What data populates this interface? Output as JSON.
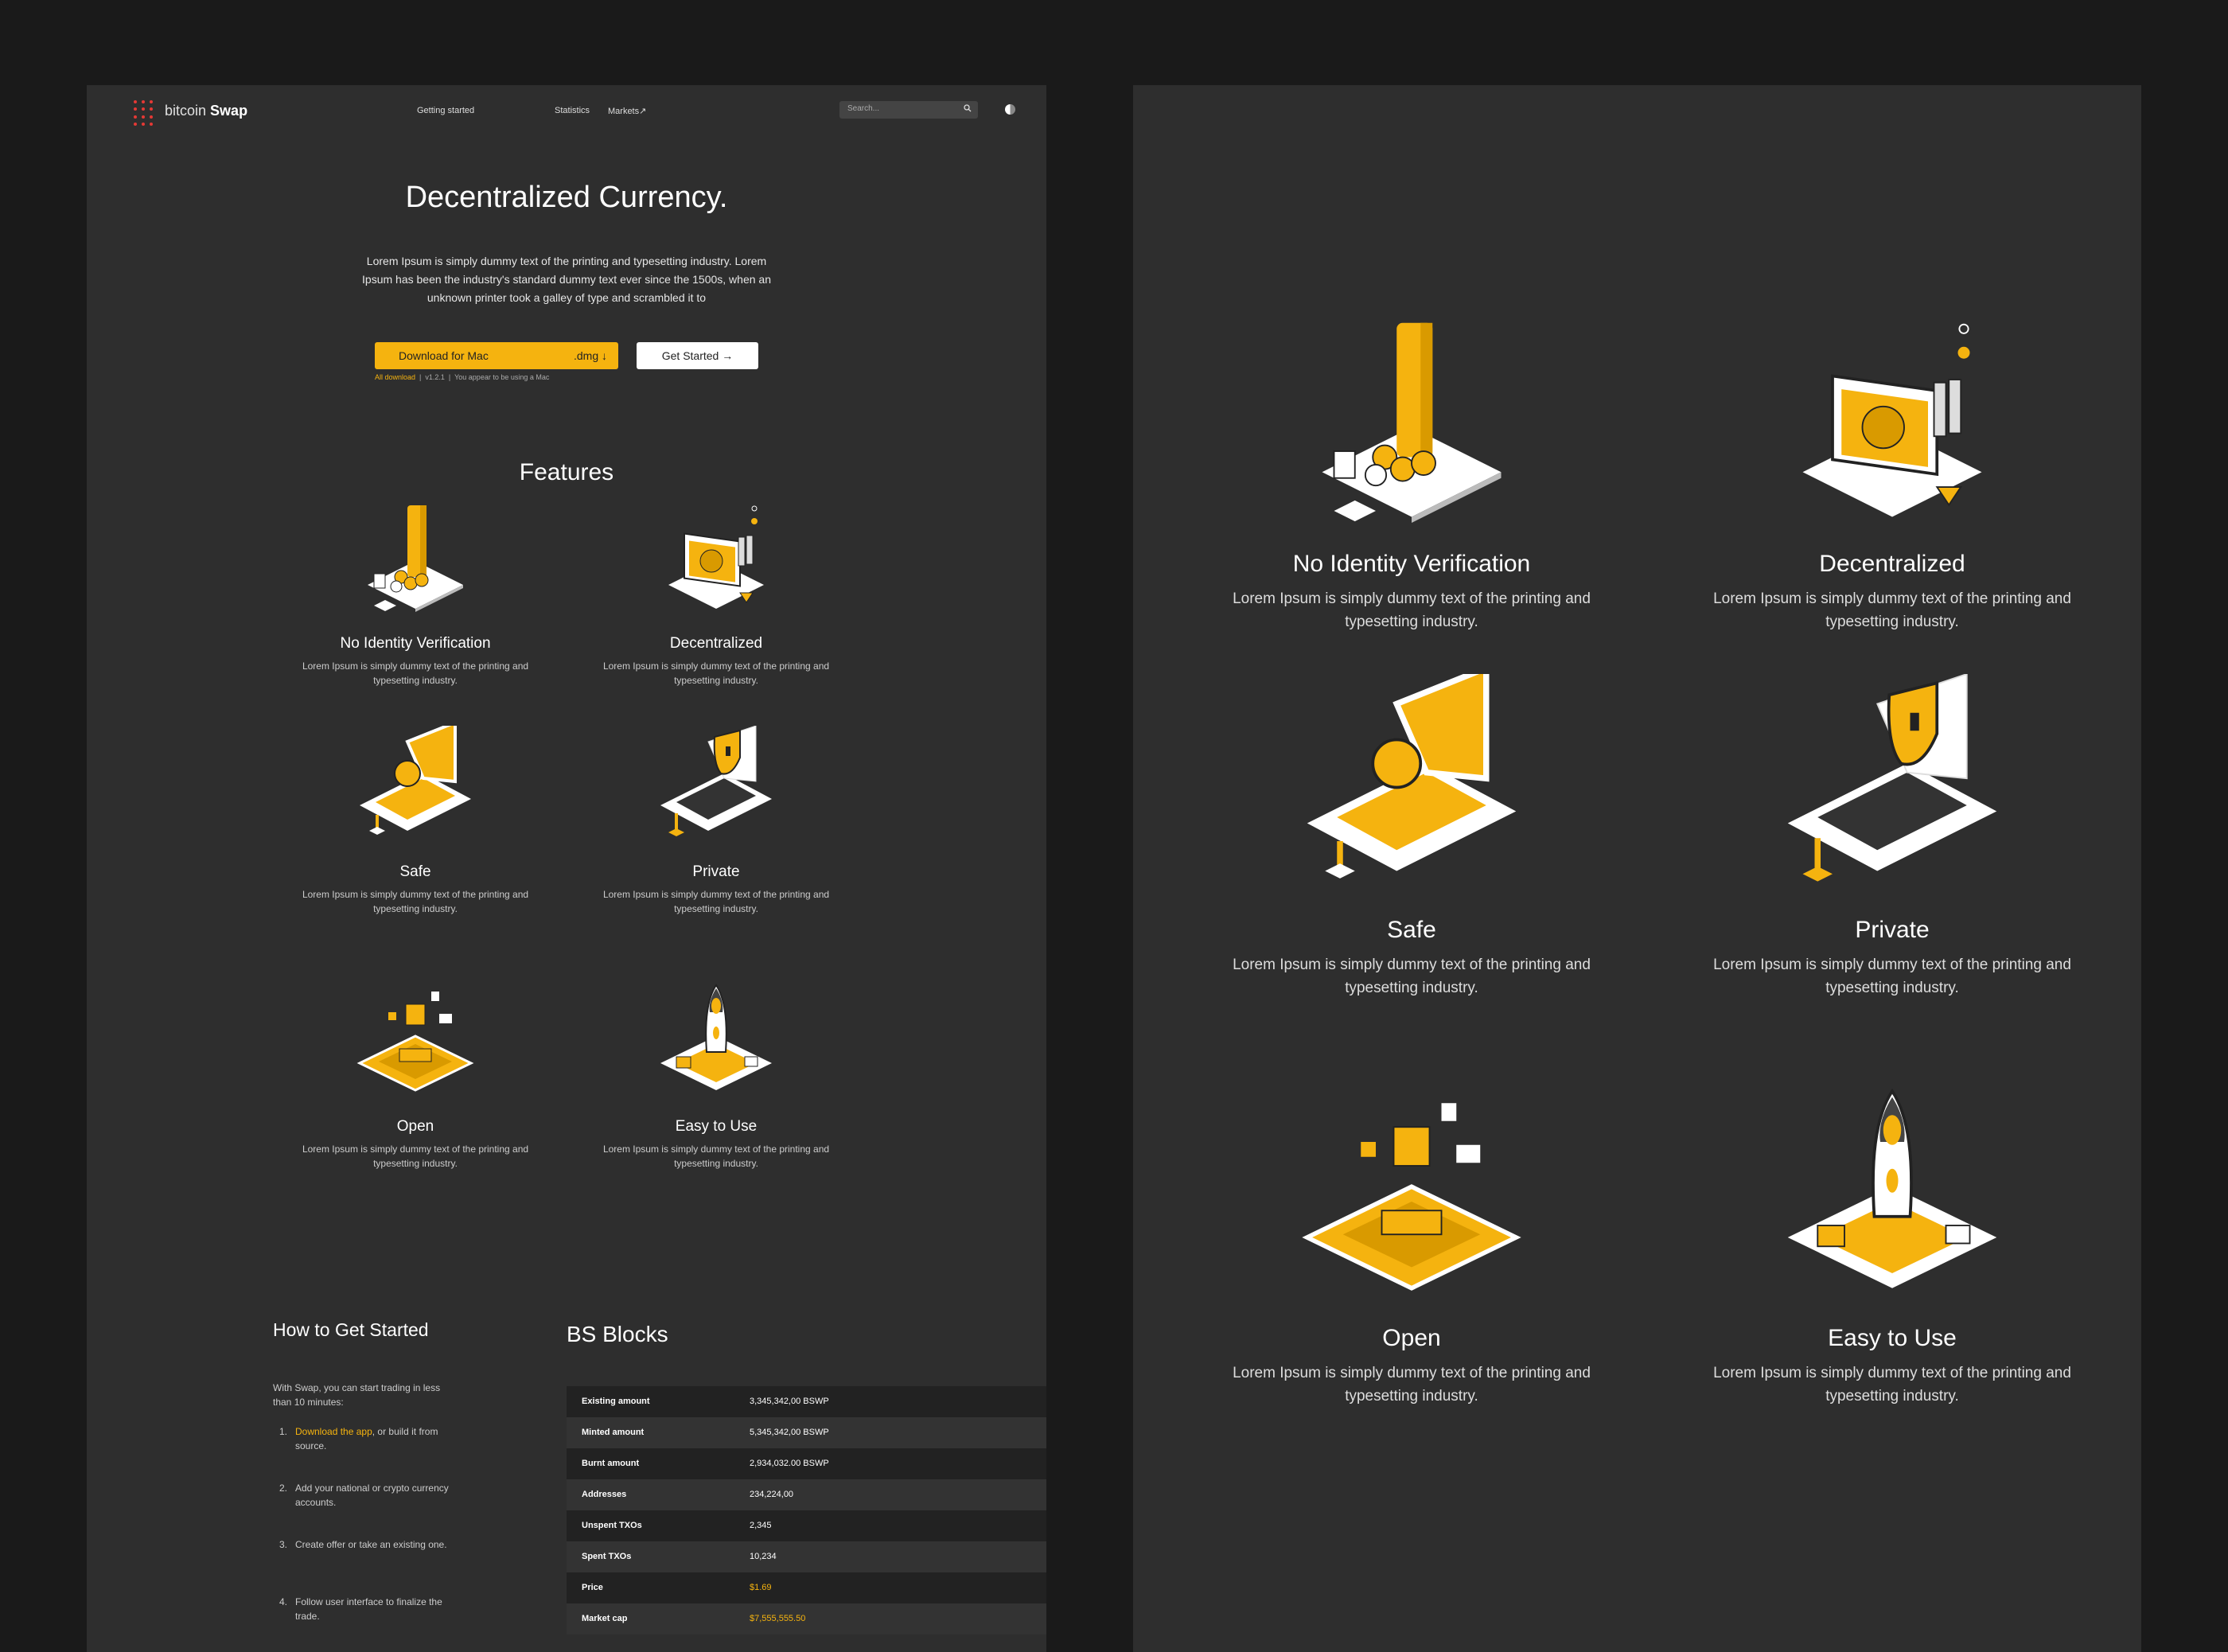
{
  "nav": {
    "brand_light": "bitcoin",
    "brand_bold": "Swap",
    "links": [
      "Getting started",
      "Statistics",
      "Markets"
    ],
    "search_placeholder": "Search..."
  },
  "hero": {
    "title": "Decentralized Currency.",
    "text": "Lorem Ipsum is simply dummy text of the printing and typesetting industry. Lorem Ipsum has been the industry's standard dummy text ever since the 1500s, when an unknown printer took a galley of type and scrambled it to",
    "download_label": "Download for Mac",
    "download_ext": ".dmg",
    "get_started_label": "Get Started",
    "sub_all": "All download",
    "sub_version": "v1.2.1",
    "sub_note": "You appear to be using a Mac"
  },
  "features": {
    "title": "Features",
    "items": [
      {
        "title": "No Identity Verification",
        "desc": "Lorem Ipsum is simply dummy text of the printing and typesetting industry."
      },
      {
        "title": "Decentralized",
        "desc": "Lorem Ipsum is simply dummy text of the printing and typesetting industry."
      },
      {
        "title": "Safe",
        "desc": "Lorem Ipsum is simply dummy text of the printing and typesetting industry."
      },
      {
        "title": "Private",
        "desc": "Lorem Ipsum is simply dummy text of the printing and typesetting industry."
      },
      {
        "title": "Open",
        "desc": "Lorem Ipsum is simply dummy text of the printing and typesetting industry."
      },
      {
        "title": "Easy to Use",
        "desc": "Lorem Ipsum is simply dummy text of the printing and typesetting industry."
      }
    ]
  },
  "how": {
    "title": "How to Get Started",
    "intro": "With Swap, you can start trading in less than 10 minutes:",
    "step1_link": "Download the app",
    "step1_rest": ", or build it from source.",
    "step2": "Add your national or crypto currency accounts.",
    "step3": "Create offer or take an existing one.",
    "step4": "Follow user interface to finalize the trade."
  },
  "blocks": {
    "title": "BS Blocks",
    "rows": [
      {
        "k": "Existing amount",
        "v": "3,345,342,00 BSWP"
      },
      {
        "k": "Minted amount",
        "v": "5,345,342,00 BSWP"
      },
      {
        "k": "Burnt amount",
        "v": "2,934,032.00 BSWP"
      },
      {
        "k": "Addresses",
        "v": "234,224,00"
      },
      {
        "k": "Unspent TXOs",
        "v": "2,345"
      },
      {
        "k": "Spent TXOs",
        "v": "10,234"
      },
      {
        "k": "Price",
        "v": "$1.69"
      },
      {
        "k": "Market cap",
        "v": "$7,555,555.50"
      }
    ]
  },
  "colors": {
    "accent": "#f5b30f",
    "panel": "#2e2e2e",
    "background": "#1a1a1a"
  }
}
